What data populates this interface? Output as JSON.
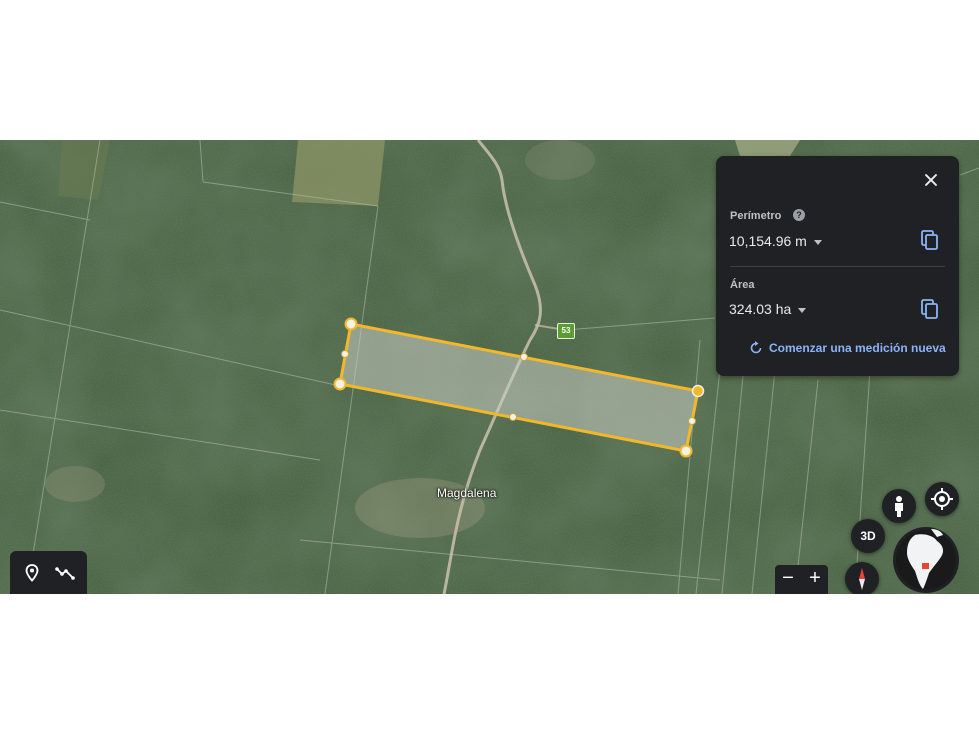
{
  "map": {
    "place_label": "Magdalena",
    "road_shield": "53"
  },
  "measure_panel": {
    "perimeter_label": "Perímetro",
    "perimeter_value": "10,154.96 m",
    "area_label": "Área",
    "area_value": "324.03 ha",
    "new_measurement_label": "Comenzar una medición nueva"
  },
  "controls": {
    "btn_3d_label": "3D",
    "zoom_out_label": "−",
    "zoom_in_label": "+"
  },
  "colors": {
    "polygon_stroke": "#f2b72b",
    "panel_bg": "#202124",
    "link_blue": "#8ab4f8",
    "road_shield_green": "#5a9e33"
  },
  "icons": {
    "toolbar": [
      "place-pin-icon",
      "measure-path-icon"
    ],
    "panel": [
      "close-icon",
      "help-icon",
      "copy-icon",
      "refresh-icon"
    ],
    "controls": [
      "pegman-icon",
      "my-location-icon",
      "compass-icon",
      "globe-icon"
    ]
  }
}
